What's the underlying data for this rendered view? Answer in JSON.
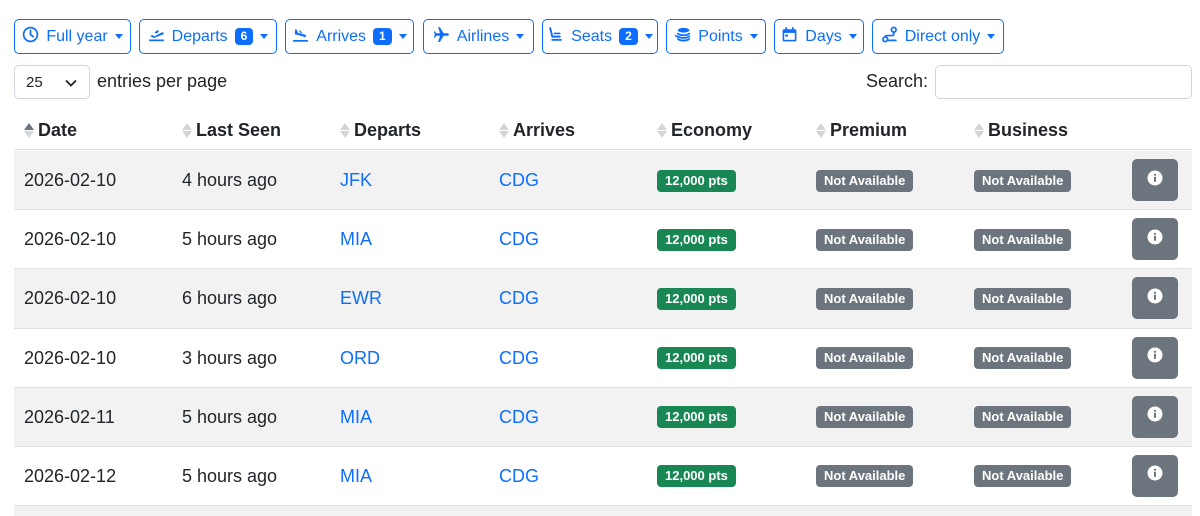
{
  "filters": [
    {
      "name": "full-year-filter",
      "icon": "clock-icon",
      "label": "Full year",
      "badge": ""
    },
    {
      "name": "departs-filter",
      "icon": "plane-departure-icon",
      "label": "Departs",
      "badge": "6"
    },
    {
      "name": "arrives-filter",
      "icon": "plane-arrival-icon",
      "label": "Arrives",
      "badge": "1"
    },
    {
      "name": "airlines-filter",
      "icon": "plane-icon",
      "label": "Airlines",
      "badge": ""
    },
    {
      "name": "seats-filter",
      "icon": "seat-icon",
      "label": "Seats",
      "badge": "2"
    },
    {
      "name": "points-filter",
      "icon": "coins-icon",
      "label": "Points",
      "badge": ""
    },
    {
      "name": "days-filter",
      "icon": "calendar-icon",
      "label": "Days",
      "badge": ""
    },
    {
      "name": "direct-only-filter",
      "icon": "route-icon",
      "label": "Direct only",
      "badge": ""
    }
  ],
  "length": {
    "value": "25",
    "label": "entries per page"
  },
  "search": {
    "label": "Search:",
    "value": ""
  },
  "columns": [
    "Date",
    "Last Seen",
    "Departs",
    "Arrives",
    "Economy",
    "Premium",
    "Business"
  ],
  "rows": [
    {
      "date": "2026-02-10",
      "last_seen": "4 hours ago",
      "departs": "JFK",
      "arrives": "CDG",
      "economy": "12,000 pts",
      "premium": "Not Available",
      "business": "Not Available"
    },
    {
      "date": "2026-02-10",
      "last_seen": "5 hours ago",
      "departs": "MIA",
      "arrives": "CDG",
      "economy": "12,000 pts",
      "premium": "Not Available",
      "business": "Not Available"
    },
    {
      "date": "2026-02-10",
      "last_seen": "6 hours ago",
      "departs": "EWR",
      "arrives": "CDG",
      "economy": "12,000 pts",
      "premium": "Not Available",
      "business": "Not Available"
    },
    {
      "date": "2026-02-10",
      "last_seen": "3 hours ago",
      "departs": "ORD",
      "arrives": "CDG",
      "economy": "12,000 pts",
      "premium": "Not Available",
      "business": "Not Available"
    },
    {
      "date": "2026-02-11",
      "last_seen": "5 hours ago",
      "departs": "MIA",
      "arrives": "CDG",
      "economy": "12,000 pts",
      "premium": "Not Available",
      "business": "Not Available"
    },
    {
      "date": "2026-02-12",
      "last_seen": "5 hours ago",
      "departs": "MIA",
      "arrives": "CDG",
      "economy": "12,000 pts",
      "premium": "Not Available",
      "business": "Not Available"
    }
  ],
  "colors": {
    "primary": "#0d6efd",
    "success": "#198754",
    "secondary": "#6c757d",
    "stripe": "#f2f2f2"
  }
}
